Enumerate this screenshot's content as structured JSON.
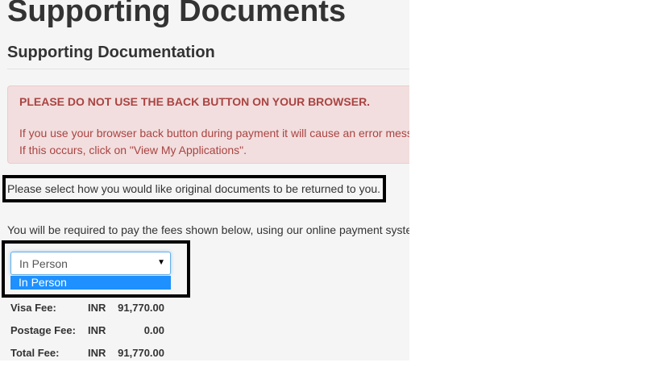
{
  "page": {
    "title": "Supporting Documents",
    "subtitle": "Supporting Documentation"
  },
  "alert": {
    "heading": "PLEASE DO NOT USE THE BACK BUTTON ON YOUR BROWSER.",
    "line1": "If you use your browser back button during payment it will cause an error mess",
    "line2": "If this occurs, click on \"View My Applications\"."
  },
  "instruction": "Please select how you would like original documents to be returned to you.",
  "fees_note": "You will be required to pay the fees shown below, using our online payment syste",
  "return_method": {
    "selected": "In Person",
    "options": [
      "In Person"
    ],
    "arrow_icon": "triangle-down-icon"
  },
  "fees": [
    {
      "label": "Visa Fee:",
      "currency": "INR",
      "amount": "91,770.00"
    },
    {
      "label": "Postage Fee:",
      "currency": "INR",
      "amount": "0.00"
    },
    {
      "label": "Total Fee:",
      "currency": "INR",
      "amount": "91,770.00"
    }
  ],
  "colors": {
    "alert_text": "#a94442",
    "alert_background": "#f2dede",
    "option_highlight": "#1e90ff",
    "annotation_border": "#000000"
  }
}
